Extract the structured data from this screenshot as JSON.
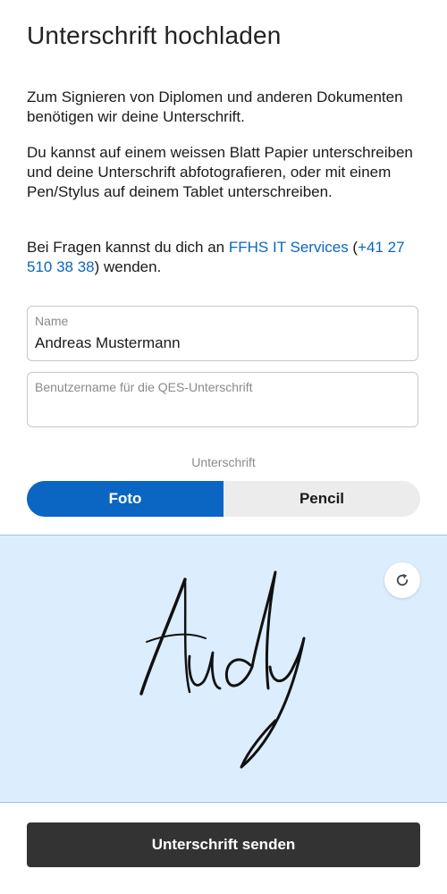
{
  "header": {
    "title": "Unterschrift hochladen"
  },
  "intro": {
    "p1": "Zum Signieren von Diplomen und anderen Dokumenten benötigen wir deine Unterschrift.",
    "p2": "Du kannst auf einem weissen Blatt Papier unterschreiben und deine Unterschrift abfotografieren, oder mit einem Pen/Stylus auf deinem Tablet unterschreiben.",
    "p3_before": "Bei Fragen kannst du dich an ",
    "p3_link": "FFHS IT Services",
    "p3_middle": " (",
    "p3_phone": "+41 27 510 38 38",
    "p3_after": ") wenden."
  },
  "form": {
    "name_label": "Name",
    "name_value": "Andreas Mustermann",
    "username_placeholder": "Benutzername für die QES-Unterschrift",
    "username_value": ""
  },
  "signature": {
    "caption": "Unterschrift",
    "modes": [
      "Foto",
      "Pencil"
    ],
    "active_mode": "Foto",
    "reset_icon": "refresh-icon"
  },
  "footer": {
    "submit_label": "Unterschrift senden"
  },
  "colors": {
    "accent": "#0a66c2",
    "signature_area": "#dcedfd",
    "submit_bg": "#333333"
  }
}
